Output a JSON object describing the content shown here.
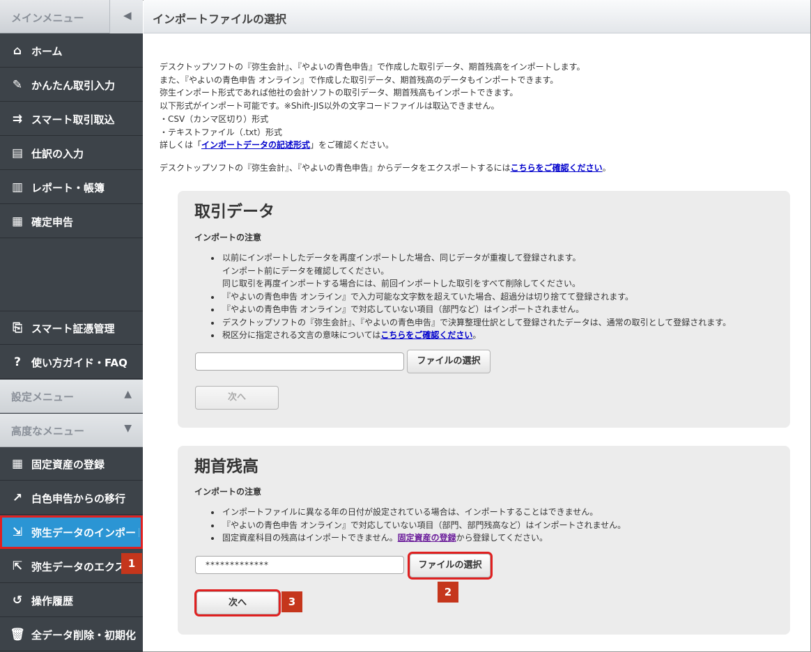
{
  "sidebar": {
    "title": "メインメニュー",
    "collapse_icon": "◀",
    "items": [
      {
        "label": "ホーム",
        "icon": "home-icon"
      },
      {
        "label": "かんたん取引入力",
        "icon": "pencil-icon"
      },
      {
        "label": "スマート取引取込",
        "icon": "import-icon"
      },
      {
        "label": "仕訳の入力",
        "icon": "journal-icon"
      },
      {
        "label": "レポート・帳簿",
        "icon": "report-icon"
      },
      {
        "label": "確定申告",
        "icon": "calculator-icon"
      }
    ],
    "bottom_items": [
      {
        "label": "スマート証憑管理",
        "icon": "receipt-icon"
      },
      {
        "label": "使い方ガイド・FAQ",
        "icon": "help-icon"
      }
    ],
    "settings_menu": {
      "label": "設定メニュー",
      "arrow": "▲"
    },
    "advanced_menu": {
      "label": "高度なメニュー",
      "arrow": "▼"
    },
    "advanced_items": [
      {
        "label": "固定資産の登録",
        "icon": "building-icon"
      },
      {
        "label": "白色申告からの移行",
        "icon": "arrow-icon"
      },
      {
        "label": "弥生データのインポート",
        "icon": "data-import-icon"
      },
      {
        "label": "弥生データのエクスポート",
        "icon": "data-export-icon"
      },
      {
        "label": "操作履歴",
        "icon": "history-icon"
      },
      {
        "label": "全データ削除・初期化",
        "icon": "trash-icon"
      }
    ]
  },
  "callouts": {
    "one": "1",
    "two": "2",
    "three": "3"
  },
  "page": {
    "title": "インポートファイルの選択"
  },
  "intro": {
    "line1": "デスクトップソフトの『弥生会計』、『やよいの青色申告』で作成した取引データ、期首残高をインポートします。",
    "line2": "また、『やよいの青色申告 オンライン』で作成した取引データ、期首残高のデータもインポートできます。",
    "line3": "弥生インポート形式であれば他社の会計ソフトの取引データ、期首残高もインポートできます。",
    "line4": "以下形式がインポート可能です。※Shift-JIS以外の文字コードファイルは取込できません。",
    "line5": "・CSV（カンマ区切り）形式",
    "line6": "・テキストファイル（.txt）形式",
    "line7_pre": "詳しくは「",
    "line7_link": "インポートデータの記述形式",
    "line7_post": "」をご確認ください。",
    "export_pre": "デスクトップソフトの『弥生会計』、『やよいの青色申告』からデータをエクスポートするには",
    "export_link": "こちらをご確認ください",
    "export_post": "。"
  },
  "transactions": {
    "heading": "取引データ",
    "note_title": "インポートの注意",
    "bullets": [
      "以前にインポートしたデータを再度インポートした場合、同じデータが重複して登録されます。",
      "インポート前にデータを確認してください。",
      "同じ取引を再度インポートする場合には、前回インポートした取引をすべて削除してください。",
      "『やよいの青色申告 オンライン』で入力可能な文字数を超えていた場合、超過分は切り捨てて登録されます。",
      "『やよいの青色申告 オンライン』で対応していない項目（部門など）はインポートされません。",
      "デスクトップソフトの『弥生会計』、『やよいの青色申告』で決算整理仕訳として登録されたデータは、通常の取引として登録されます。",
      "税区分に指定される文言の意味については"
    ],
    "tax_link": "こちらをご確認ください",
    "tax_post": "。",
    "file_value": "",
    "file_button": "ファイルの選択",
    "next_button": "次へ"
  },
  "opening": {
    "heading": "期首残高",
    "note_title": "インポートの注意",
    "bullets": [
      "インポートファイルに異なる年の日付が設定されている場合は、インポートすることはできません。",
      "『やよいの青色申告 オンライン』で対応していない項目（部門、部門残高など）はインポートされません。",
      "固定資産科目の残高はインポートできません。"
    ],
    "asset_link": "固定資産の登録",
    "asset_post": "から登録してください。",
    "file_value": "*************",
    "file_button": "ファイルの選択",
    "next_button": "次へ"
  }
}
